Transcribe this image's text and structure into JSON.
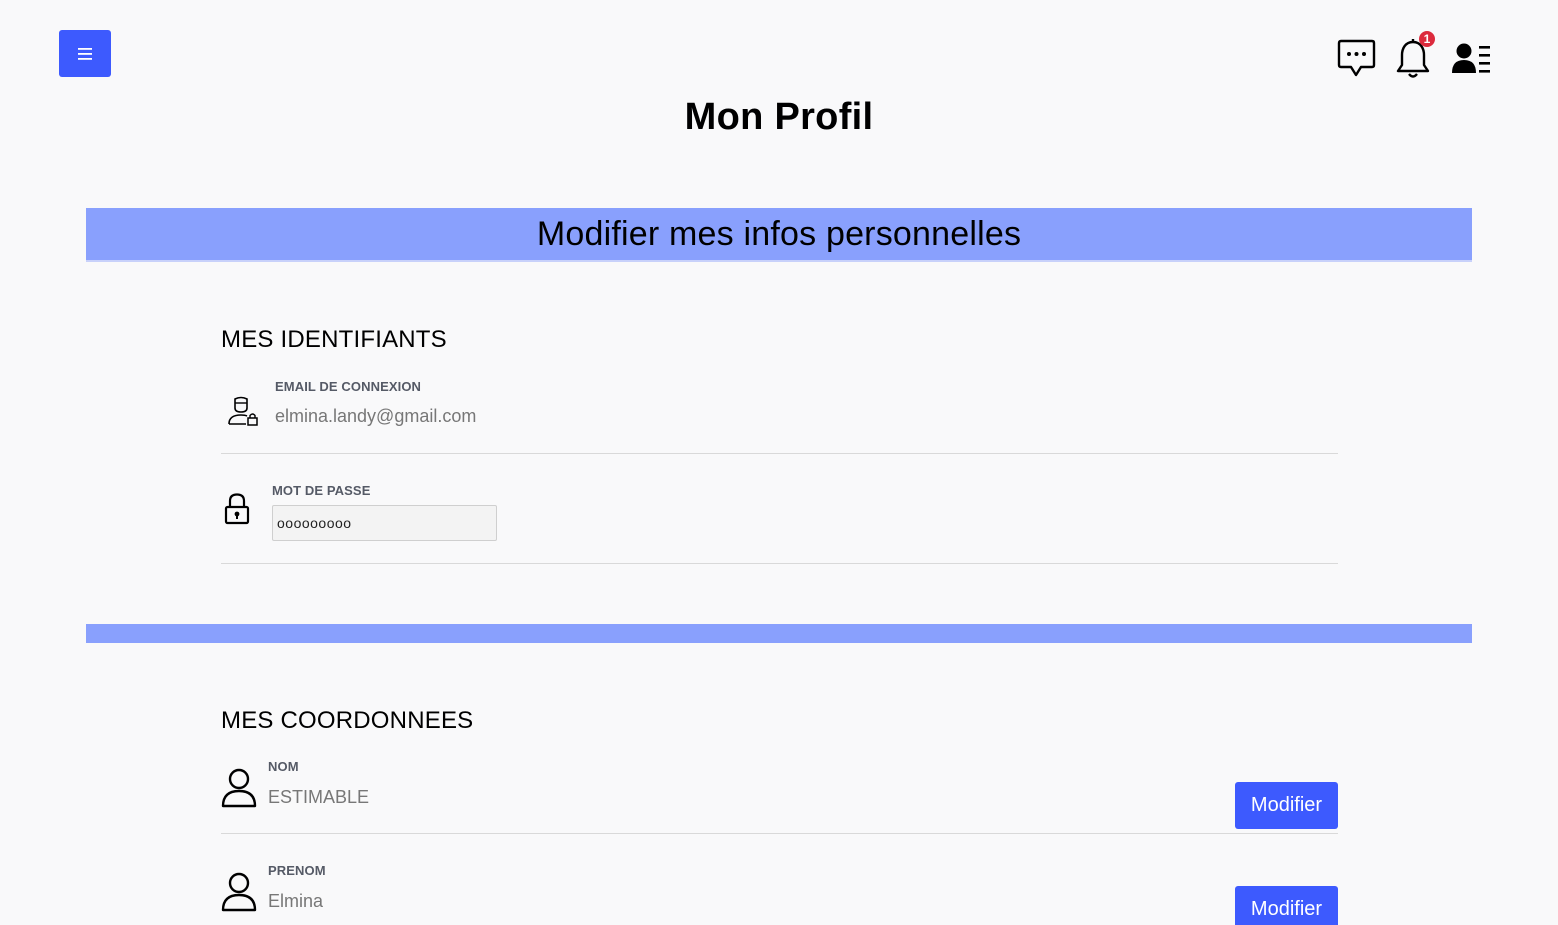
{
  "header": {
    "menu_icon": "hamburger-icon",
    "chat_icon": "chat-icon",
    "notification_icon": "bell-icon",
    "notification_count": "1",
    "profile_icon": "user-list-icon"
  },
  "page": {
    "title": "Mon Profil",
    "banner": "Modifier mes infos personnelles"
  },
  "identifiants": {
    "title": "MES IDENTIFIANTS",
    "email": {
      "label": "EMAIL DE CONNEXION",
      "value": "elmina.landy@gmail.com",
      "icon": "user-lock-icon"
    },
    "password": {
      "label": "MOT DE PASSE",
      "value": "ooooooooo",
      "icon": "lock-icon"
    }
  },
  "coordonnees": {
    "title": "MES COORDONNEES",
    "fields": [
      {
        "label": "NOM",
        "value": "ESTIMABLE",
        "button": "Modifier",
        "icon": "user-icon"
      },
      {
        "label": "PRENOM",
        "value": "Elmina",
        "button": "Modifier",
        "icon": "user-icon"
      }
    ]
  },
  "colors": {
    "primary": "#3d5afe",
    "band": "#89a0fd",
    "badge": "#dc2b3d"
  }
}
